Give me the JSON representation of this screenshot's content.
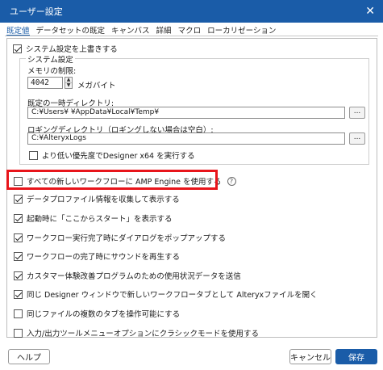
{
  "dialog": {
    "title": "ユーザー設定",
    "close_glyph": "✕"
  },
  "tabs": [
    "既定値",
    "データセットの既定",
    "キャンバス",
    "詳細",
    "マクロ",
    "ローカリゼーション"
  ],
  "system": {
    "override_label": "システム設定を上書きする",
    "override_checked": true,
    "group_title": "システム設定",
    "memory_label": "メモリの制限:",
    "memory_value": "4042",
    "memory_unit": "メガバイト",
    "temp_dir_label": "既定の一時ディレクトリ:",
    "temp_dir_value": "C:¥Users¥        ¥AppData¥Local¥Temp¥",
    "log_dir_label": "ロギングディレクトリ（ロギングしない場合は空白）:",
    "log_dir_value": "C:¥AlteryxLogs",
    "browse_label": "...",
    "low_priority_label": "より低い優先度でDesigner x64 を実行する",
    "low_priority_checked": false
  },
  "options": [
    {
      "label": "すべての新しいワークフローに AMP Engine を使用する",
      "checked": false,
      "help": "?"
    },
    {
      "label": "データプロファイル情報を収集して表示する",
      "checked": true
    },
    {
      "label": "起動時に「ここからスタート」を表示する",
      "checked": true
    },
    {
      "label": "ワークフロー実行完了時にダイアログをポップアップする",
      "checked": true
    },
    {
      "label": "ワークフローの完了時にサウンドを再生する",
      "checked": true
    },
    {
      "label": "カスタマー体験改善プログラムのための使用状況データを送信",
      "checked": true
    },
    {
      "label": "同じ Designer ウィンドウで新しいワークフロータブとして Alteryxファイルを開く",
      "checked": true
    },
    {
      "label": "同じファイルの複数のタブを操作可能にする",
      "checked": false
    },
    {
      "label": "入力/出力ツールメニューオプションにクラシックモードを使用する",
      "checked": false
    }
  ],
  "footer": {
    "help_label": "ヘルプ",
    "cancel_label": "キャンセル",
    "save_label": "保存"
  },
  "colors": {
    "titlebar": "#1a5ca8",
    "highlight": "#e8151b",
    "primary": "#1a5ca8"
  }
}
